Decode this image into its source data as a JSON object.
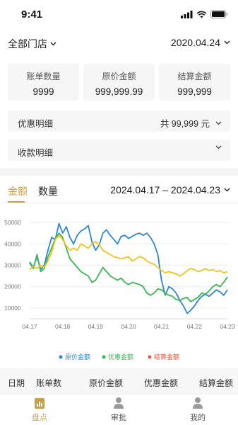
{
  "status_bar": {
    "time": "9:41"
  },
  "header": {
    "store": "全部门店",
    "date": "2020.04.24"
  },
  "summary": [
    {
      "label": "账单数量",
      "value": "9999"
    },
    {
      "label": "原价金额",
      "value": "999,999.99"
    },
    {
      "label": "结算金额",
      "value": "999,999"
    }
  ],
  "discount_detail": {
    "label": "优惠明细",
    "total": "共 99,999 元"
  },
  "receipt_detail": {
    "label": "收款明细"
  },
  "tabs": [
    {
      "label": "金额"
    },
    {
      "label": "数量"
    }
  ],
  "date_range": "2024.04.17 – 2024.04.23",
  "chart_data": {
    "type": "line",
    "x_ticks": [
      "04.17",
      "04.18",
      "04.19",
      "04.20",
      "04.21",
      "04.22",
      "04.23"
    ],
    "y_ticks": [
      10000,
      20000,
      30000,
      40000,
      50000
    ],
    "ylim": [
      5000,
      52000
    ],
    "grid": true,
    "legend_position": "bottom",
    "series": [
      {
        "name": "原价金额",
        "color": "#2b86d9",
        "values": [
          31500,
          29000,
          34000,
          28000,
          30000,
          37000,
          43000,
          42000,
          49500,
          45000,
          48000,
          43000,
          40000,
          44000,
          46000,
          47000,
          48500,
          41000,
          37000,
          39500,
          45000,
          46500,
          44000,
          42000,
          40000,
          43500,
          44000,
          42500,
          43500,
          44500,
          45000,
          44000,
          45000,
          43000,
          40000,
          35000,
          23000,
          16000,
          20000,
          19000,
          17000,
          13500,
          11000,
          7500,
          9000,
          11000,
          13500,
          15500,
          16500,
          15500,
          17000,
          18500,
          17500,
          16000,
          18500
        ]
      },
      {
        "name": "优惠金额",
        "color": "#3cb554",
        "values": [
          31000,
          28500,
          35000,
          27000,
          28500,
          34000,
          38000,
          42500,
          45000,
          43000,
          38000,
          33000,
          31000,
          29000,
          27000,
          26000,
          25000,
          22000,
          23000,
          26000,
          29000,
          27000,
          25000,
          24000,
          23000,
          24000,
          22000,
          21000,
          22000,
          21500,
          21000,
          20000,
          17000,
          16000,
          17000,
          19000,
          18500,
          17000,
          16000,
          15500,
          14000,
          13500,
          14500,
          15000,
          13000,
          14000,
          15000,
          17000,
          16500,
          18000,
          20000,
          21000,
          20000,
          22000,
          24500
        ]
      },
      {
        "name": "结算金额",
        "color": "#f05a3c",
        "values": []
      },
      {
        "name": "",
        "color": "#f2c21e",
        "values": [
          28000,
          29500,
          28500,
          30000,
          29000,
          32000,
          36000,
          42000,
          44000,
          42000,
          39000,
          37000,
          38000,
          37000,
          40000,
          39000,
          38000,
          40000,
          41000,
          39500,
          37000,
          36000,
          35000,
          34000,
          33500,
          33000,
          33500,
          34000,
          32000,
          33000,
          34000,
          33500,
          32000,
          31000,
          30500,
          29000,
          27500,
          26500,
          27000,
          26500,
          26000,
          25000,
          26000,
          27500,
          28500,
          28000,
          27000,
          27500,
          28500,
          27500,
          28000,
          27000,
          27500,
          26500,
          27000
        ]
      }
    ]
  },
  "table_columns": [
    "日期",
    "账单数",
    "原价金额",
    "优惠金额",
    "结算金额"
  ],
  "tab_bar": [
    {
      "label": "盘点",
      "icon": "inventory-icon",
      "active": true
    },
    {
      "label": "审批",
      "icon": "approval-icon",
      "active": false
    },
    {
      "label": "我的",
      "icon": "profile-icon",
      "active": false
    }
  ],
  "colors": {
    "accent": "#c9a04a",
    "inactive": "#8a8a8a"
  }
}
